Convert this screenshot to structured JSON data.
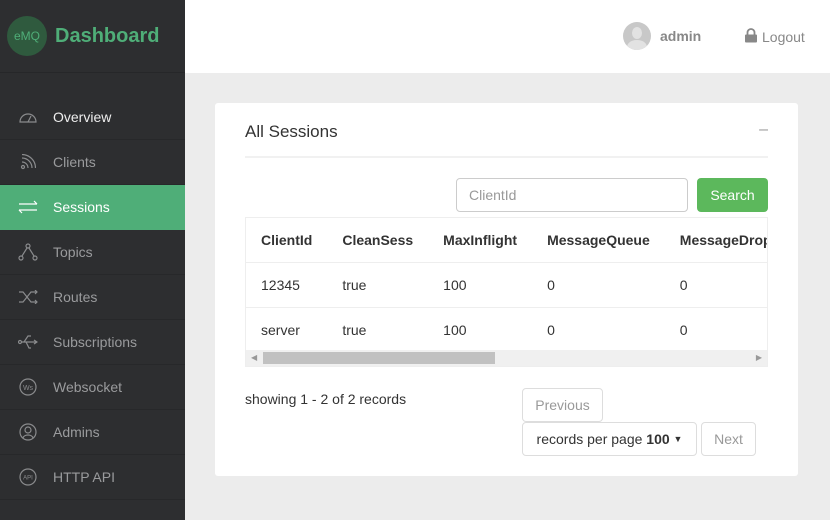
{
  "brand": {
    "logo": "eMQ",
    "name": "Dashboard",
    "accent": "#4fae78"
  },
  "sidebar": {
    "items": [
      {
        "label": "Overview",
        "icon": "gauge-icon"
      },
      {
        "label": "Clients",
        "icon": "rss-icon"
      },
      {
        "label": "Sessions",
        "icon": "exchange-icon",
        "active": true
      },
      {
        "label": "Topics",
        "icon": "share-nodes-icon"
      },
      {
        "label": "Routes",
        "icon": "shuffle-icon"
      },
      {
        "label": "Subscriptions",
        "icon": "usb-icon"
      },
      {
        "label": "Websocket",
        "icon": "ws-icon"
      },
      {
        "label": "Admins",
        "icon": "user-circle-icon"
      },
      {
        "label": "HTTP API",
        "icon": "api-icon"
      }
    ]
  },
  "header": {
    "user": "admin",
    "logout": "Logout"
  },
  "card": {
    "title": "All Sessions",
    "collapse": "–"
  },
  "search": {
    "placeholder": "ClientId",
    "button": "Search"
  },
  "table": {
    "columns": [
      "ClientId",
      "CleanSess",
      "MaxInflight",
      "MessageQueue",
      "MessageDropped"
    ],
    "rows": [
      [
        "12345",
        "true",
        "100",
        "0",
        "0"
      ],
      [
        "server",
        "true",
        "100",
        "0",
        "0"
      ]
    ]
  },
  "pagination": {
    "showing": "showing 1 - 2 of 2 records",
    "previous": "Previous",
    "records_label": "records per page",
    "records_value": "100",
    "next": "Next"
  }
}
